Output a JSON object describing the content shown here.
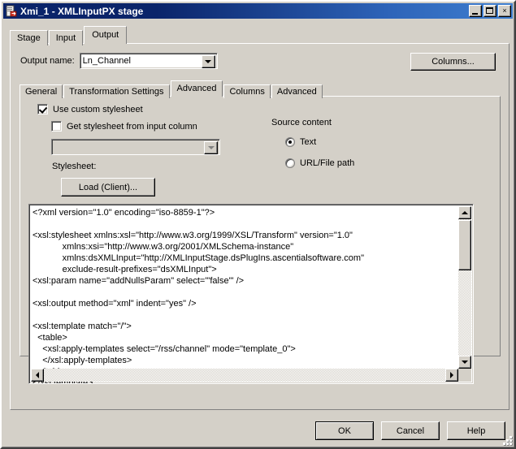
{
  "window": {
    "title": "Xmi_1 - XMLInputPX stage",
    "icon": "xml-stage-icon",
    "buttons": {
      "minimize": "minimize-button",
      "maximize": "maximize-button",
      "close": "×"
    }
  },
  "outer_tabs": [
    {
      "label": "Stage",
      "selected": false
    },
    {
      "label": "Input",
      "selected": false
    },
    {
      "label": "Output",
      "selected": true
    }
  ],
  "output_name": {
    "label": "Output name:",
    "value": "Ln_Channel"
  },
  "columns_button": {
    "label": "Columns..."
  },
  "inner_tabs": [
    {
      "label": "General",
      "selected": false
    },
    {
      "label": "Transformation Settings",
      "selected": false
    },
    {
      "label": "Advanced",
      "selected": true
    },
    {
      "label": "Columns",
      "selected": false
    },
    {
      "label": "Advanced",
      "selected": false
    }
  ],
  "options": {
    "use_custom_stylesheet": {
      "label": "Use custom stylesheet",
      "checked": true
    },
    "get_stylesheet_from_input_column": {
      "label": "Get stylesheet from input column",
      "checked": false
    },
    "input_column_combo": {
      "value": "",
      "enabled": false
    }
  },
  "source_content": {
    "group_label": "Source content",
    "options": [
      {
        "label": "Text",
        "selected": true
      },
      {
        "label": "URL/File path",
        "selected": false
      }
    ]
  },
  "stylesheet": {
    "label": "Stylesheet:",
    "load_button": "Load (Client)...",
    "content": "<?xml version=\"1.0\" encoding=\"iso-8859-1\"?>\n\n<xsl:stylesheet xmlns:xsl=\"http://www.w3.org/1999/XSL/Transform\" version=\"1.0\"\n            xmlns:xsi=\"http://www.w3.org/2001/XMLSchema-instance\"\n            xmlns:dsXMLInput=\"http://XMLInputStage.dsPlugIns.ascentialsoftware.com\"\n            exclude-result-prefixes=\"dsXMLInput\">\n<xsl:param name=\"addNullsParam\" select=\"'false'\" />\n\n<xsl:output method=\"xml\" indent=\"yes\" />\n\n<xsl:template match=\"/\">\n  <table>\n    <xsl:apply-templates select=\"/rss/channel\" mode=\"template_0\">\n    </xsl:apply-templates>\n  </table>\n</xsl:template>"
  },
  "scrollbars": {
    "vertical": {
      "up": "scroll-up-arrow",
      "down": "scroll-down-arrow"
    },
    "horizontal": {
      "left": "scroll-left-arrow",
      "right": "scroll-right-arrow"
    }
  },
  "dialog_buttons": [
    {
      "label": "OK",
      "default": true
    },
    {
      "label": "Cancel",
      "default": false
    },
    {
      "label": "Help",
      "default": false
    }
  ]
}
